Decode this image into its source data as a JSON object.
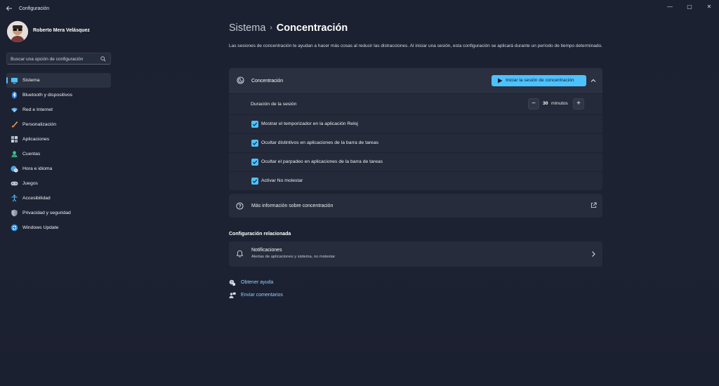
{
  "window": {
    "title": "Configuración",
    "controls": {
      "minimize": "—",
      "maximize": "▢",
      "close": "✕"
    }
  },
  "profile": {
    "name": "Roberto Mera Velásquez"
  },
  "search": {
    "placeholder": "Buscar una opción de configuración"
  },
  "sidebar": {
    "items": [
      {
        "label": "Sistema",
        "icon": "display-icon",
        "active": true
      },
      {
        "label": "Bluetooth y dispositivos",
        "icon": "bluetooth-icon"
      },
      {
        "label": "Red e Internet",
        "icon": "wifi-icon"
      },
      {
        "label": "Personalización",
        "icon": "brush-icon"
      },
      {
        "label": "Aplicaciones",
        "icon": "apps-icon"
      },
      {
        "label": "Cuentas",
        "icon": "account-icon"
      },
      {
        "label": "Hora e idioma",
        "icon": "globe-clock-icon"
      },
      {
        "label": "Juegos",
        "icon": "gamepad-icon"
      },
      {
        "label": "Accesibilidad",
        "icon": "accessibility-icon"
      },
      {
        "label": "Privacidad y seguridad",
        "icon": "shield-icon"
      },
      {
        "label": "Windows Update",
        "icon": "update-icon"
      }
    ]
  },
  "breadcrumb": {
    "parent": "Sistema",
    "separator": "›",
    "current": "Concentración"
  },
  "description": "Las sesiones de concentración te ayudan a hacer más cosas al reducir las distracciones. Al iniciar una sesión, esta configuración se aplicará durante un período de tiempo determinado.",
  "focus_card": {
    "title": "Concentración",
    "start_label": "Iniciar la sesión de concentración",
    "duration": {
      "label": "Duración de la sesión",
      "value": "30",
      "unit": "minutos",
      "minus": "−",
      "plus": "+"
    },
    "options": [
      {
        "label": "Mostrar el temporizador en la aplicación Reloj",
        "checked": true
      },
      {
        "label": "Ocultar distintivos en aplicaciones de la barra de tareas",
        "checked": true
      },
      {
        "label": "Ocultar el parpadeo en aplicaciones de la barra de tareas",
        "checked": true
      },
      {
        "label": "Activar No molestar",
        "checked": true
      }
    ]
  },
  "more_info": {
    "label": "Más información sobre concentración"
  },
  "related": {
    "title": "Configuración relacionada",
    "notifications": {
      "title": "Notificaciones",
      "subtitle": "Alertas de aplicaciones y sistema, no molestar"
    }
  },
  "links": {
    "help": "Obtener ayuda",
    "feedback": "Enviar comentarios"
  },
  "colors": {
    "accent": "#4cc2ff",
    "background": "#1c2231",
    "card": "#262c3b"
  }
}
